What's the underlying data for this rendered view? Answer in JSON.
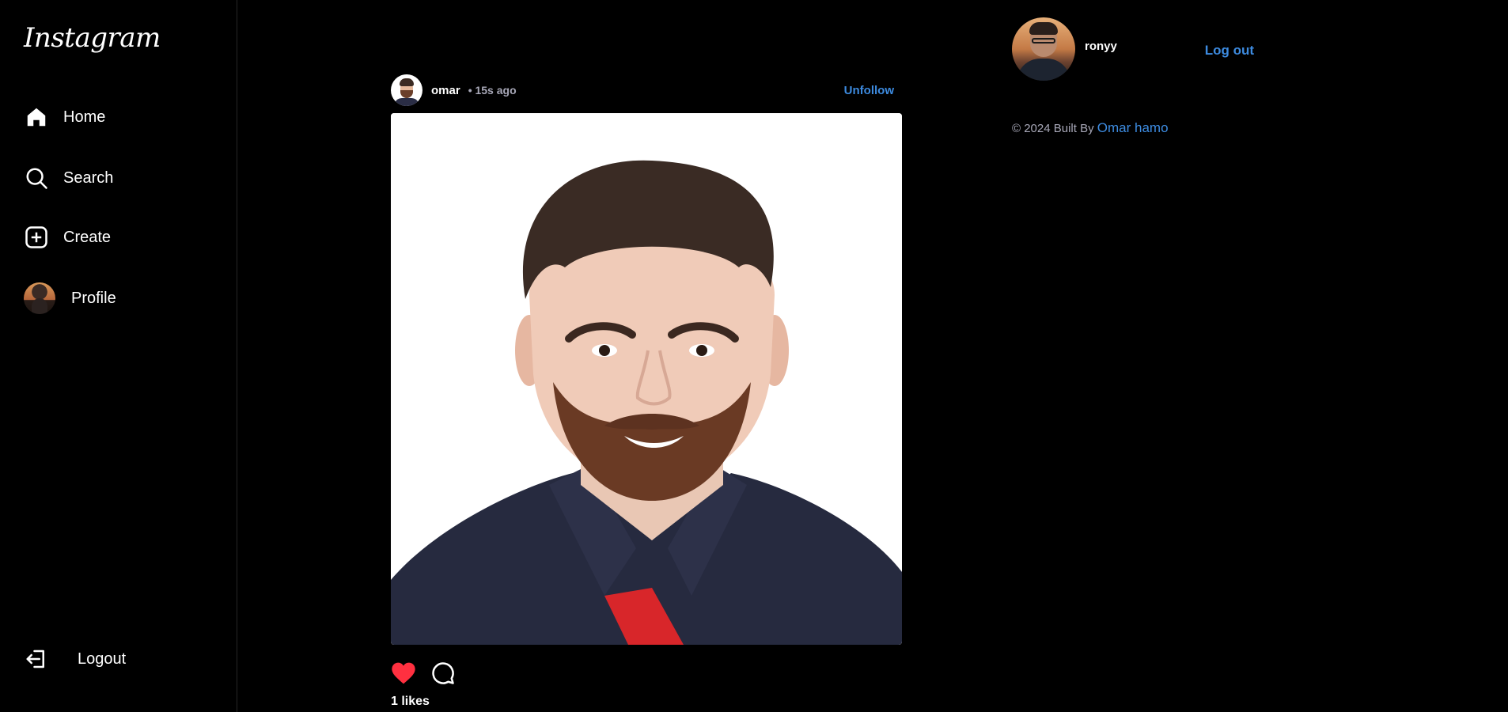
{
  "app": {
    "logo_text": "Instagram"
  },
  "sidebar": {
    "items": [
      {
        "label": "Home",
        "icon": "home-icon"
      },
      {
        "label": "Search",
        "icon": "search-icon"
      },
      {
        "label": "Create",
        "icon": "create-icon"
      },
      {
        "label": "Profile",
        "icon": "avatar"
      }
    ],
    "logout_label": "Logout"
  },
  "post": {
    "username": "omar",
    "time": "• 15s ago",
    "unfollow_label": "Unfollow",
    "likes_text": "1 likes",
    "liked": true,
    "like_color": "#ff3040"
  },
  "right_panel": {
    "username": "ronyy",
    "logout_label": "Log out",
    "footer_prefix": "© 2024 Built By",
    "footer_author": "Omar hamo"
  },
  "colors": {
    "accent": "#3d8be0",
    "background": "#000000",
    "muted": "#a8a8b8"
  }
}
